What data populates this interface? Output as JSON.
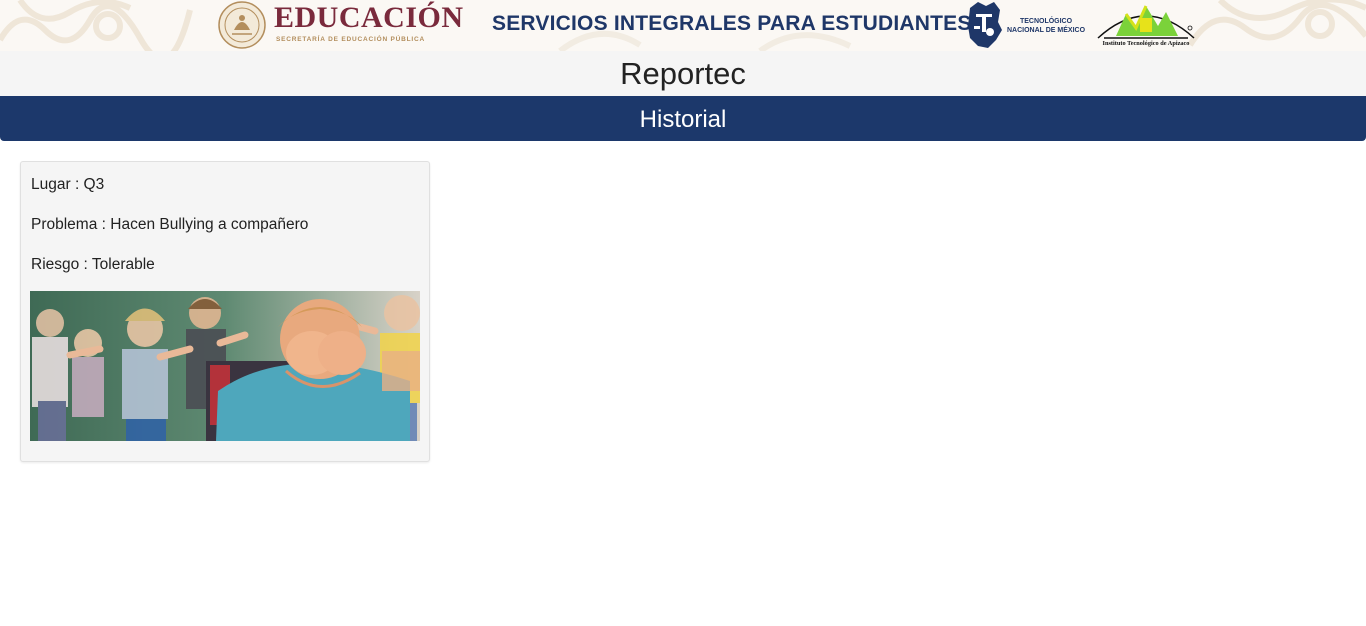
{
  "banner": {
    "sep_title": "EDUCACIÓN",
    "sep_subtitle": "SECRETARÍA DE EDUCACIÓN PÚBLICA",
    "services_title": "SERVICIOS INTEGRALES PARA ESTUDIANTES",
    "tecnm_line1": "TECNOLÓGICO",
    "tecnm_line2": "NACIONAL DE MÉXICO",
    "apizaco_name": "Instituto Tecnológico de Apizaco"
  },
  "app": {
    "title": "Reportec"
  },
  "section": {
    "title": "Historial"
  },
  "reports": [
    {
      "lugar_label": "Lugar",
      "lugar": "Q3",
      "lugar_text": "Lugar : Q3",
      "problema_label": "Problema",
      "problema": "Hacen Bullying a compañero",
      "problema_text": "Problema : Hacen Bullying a compañero",
      "riesgo_label": "Riesgo",
      "riesgo": "Tolerable",
      "riesgo_text": "Riesgo : Tolerable",
      "image": "photo-child-being-bullied"
    }
  ],
  "colors": {
    "navy": "#1c386b",
    "sep_maroon": "#7a2a3c",
    "sep_gold": "#b38e5d",
    "title_bar_bg": "#f5f5f5",
    "card_bg": "#f5f5f5"
  }
}
